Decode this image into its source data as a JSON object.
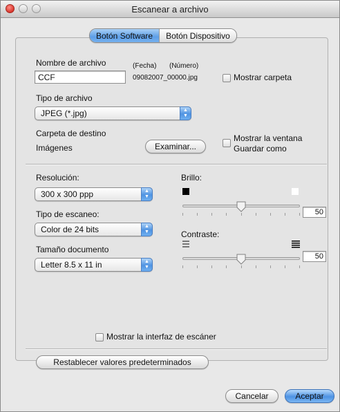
{
  "window": {
    "title": "Escanear a archivo"
  },
  "tabs": [
    {
      "label": "Botón Software"
    },
    {
      "label": "Botón Dispositivo"
    }
  ],
  "file_name": {
    "label": "Nombre de archivo",
    "value": "CCF",
    "date_caption": "(Fecha)",
    "number_caption": "(Número)",
    "generated_name": "09082007_00000.jpg",
    "show_folder_label": "Mostrar carpeta"
  },
  "file_type": {
    "label": "Tipo de archivo",
    "selected": "JPEG (*.jpg)"
  },
  "destination": {
    "label": "Carpeta de destino",
    "folder": "Imágenes",
    "browse_label": "Examinar...",
    "save_as_label_line1": "Mostrar la ventana",
    "save_as_label_line2": "Guardar como"
  },
  "resolution": {
    "label": "Resolución:",
    "selected": "300 x 300 ppp"
  },
  "scan_type": {
    "label": "Tipo de escaneo:",
    "selected": "Color de 24 bits"
  },
  "document_size": {
    "label": "Tamaño documento",
    "selected": "Letter  8.5 x 11 in"
  },
  "brightness": {
    "label": "Brillo:",
    "value": "50",
    "fraction": 0.5
  },
  "contrast": {
    "label": "Contraste:",
    "value": "50",
    "fraction": 0.5
  },
  "scanner_interface_label": "Mostrar la interfaz de escáner",
  "restore_defaults_label": "Restablecer valores predeterminados",
  "cancel_label": "Cancelar",
  "accept_label": "Aceptar",
  "colors": {
    "accent": "#5d9ee7",
    "close": "#d8352b"
  }
}
